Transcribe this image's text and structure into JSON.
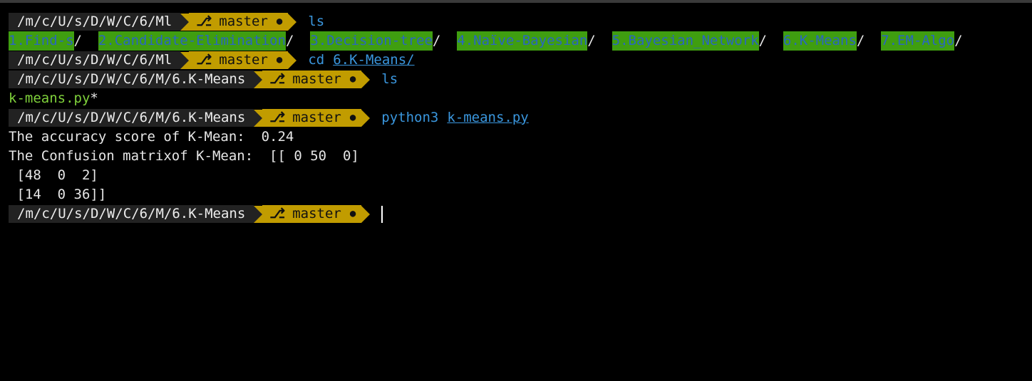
{
  "prompt": {
    "path_short": "/m/c/U/s/D/W/C/6/Ml",
    "path_long": "/m/c/U/s/D/W/C/6/M/6.K-Means",
    "branch": "master",
    "git_icon": "⎇",
    "dirty_marker": "●"
  },
  "commands": {
    "ls1": "ls",
    "cd": "cd",
    "cd_arg": "6.K-Means/",
    "ls2": "ls",
    "python": "python3",
    "python_arg": "k-means.py"
  },
  "listing": [
    {
      "name": "1.Find-s",
      "sep": "/"
    },
    {
      "name": "2.Candidate-Elimination",
      "sep": "/"
    },
    {
      "name": "3.Decision-tree",
      "sep": "/"
    },
    {
      "name": "4.Naïve-Bayesian",
      "sep": "/"
    },
    {
      "name": "5.Bayesian_Network",
      "sep": "/"
    },
    {
      "name": "6.K-Means",
      "sep": "/"
    },
    {
      "name": "7.EM-Algo",
      "sep": "/"
    }
  ],
  "kmeans_listing": {
    "file": "k-means.py",
    "marker": "*"
  },
  "output": {
    "accuracy": "The accuracy score of K-Mean:  0.24",
    "confusion1": "The Confusion matrixof K-Mean:  [[ 0 50  0]",
    "confusion2": " [48  0  2]",
    "confusion3": " [14  0 36]]"
  },
  "colors": {
    "background": "#000000",
    "path_segment": "#222222",
    "git_segment": "#c19c00",
    "command": "#3a96dd",
    "dir_bg": "#3f9e10",
    "exe": "#7fd13b"
  }
}
